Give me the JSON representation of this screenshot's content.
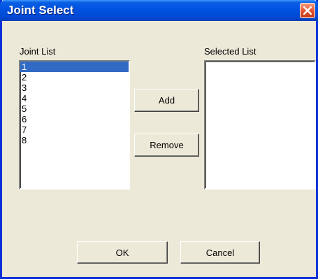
{
  "window": {
    "title": "Joint Select"
  },
  "joint_list": {
    "label": "Joint List",
    "items": [
      "1",
      "2",
      "3",
      "4",
      "5",
      "6",
      "7",
      "8"
    ],
    "selected": "1"
  },
  "selected_list": {
    "label": "Selected List",
    "items": []
  },
  "buttons": {
    "add": "Add",
    "remove": "Remove",
    "ok": "OK",
    "cancel": "Cancel"
  },
  "colors": {
    "titlebar": "#0054e3",
    "selection": "#316ac5",
    "close": "#e2502b",
    "face": "#ece9d8"
  }
}
